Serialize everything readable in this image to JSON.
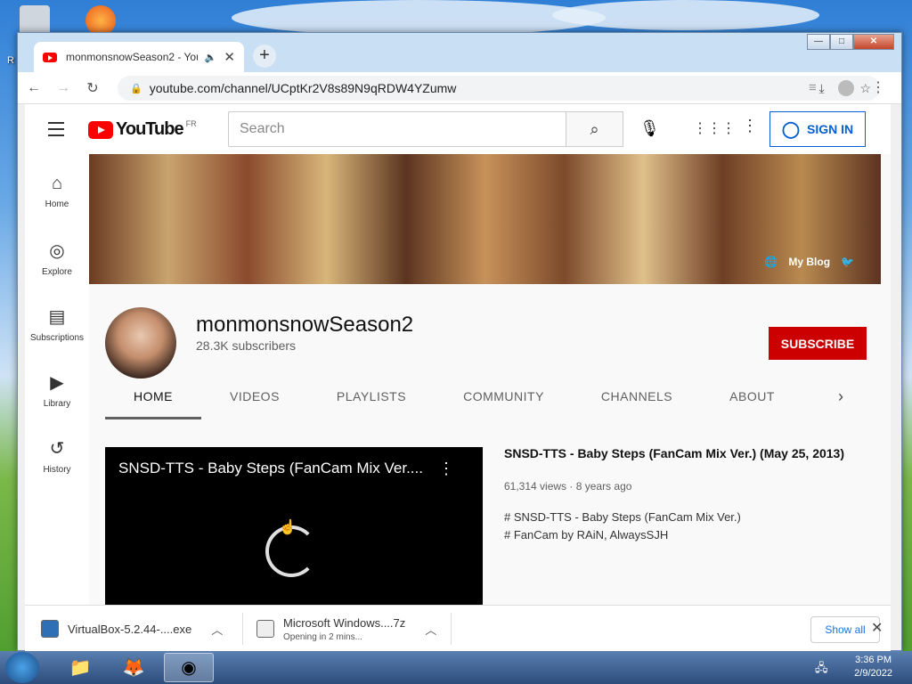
{
  "desktop": {
    "recycle_label": "R"
  },
  "tab": {
    "title": "monmonsnowSeason2 - You",
    "close": "✕",
    "new_tab": "+"
  },
  "window_controls": {
    "minimize": "—",
    "maximize": "□",
    "close": "✕"
  },
  "address_bar": {
    "url": "youtube.com/channel/UCptKr2V8s89N9qRDW4YZumw"
  },
  "youtube": {
    "logo_word": "YouTube",
    "region": "FR",
    "search_placeholder": "Search",
    "sign_in": "SIGN IN",
    "sidebar": [
      {
        "label": "Home",
        "icon": "⌂"
      },
      {
        "label": "Explore",
        "icon": "◎"
      },
      {
        "label": "Subscriptions",
        "icon": "▤"
      },
      {
        "label": "Library",
        "icon": "▶"
      },
      {
        "label": "History",
        "icon": "↺"
      }
    ],
    "banner_link": "My Blog",
    "channel": {
      "name": "monmonsnowSeason2",
      "subscribers": "28.3K subscribers",
      "subscribe": "SUBSCRIBE"
    },
    "tabs": [
      "HOME",
      "VIDEOS",
      "PLAYLISTS",
      "COMMUNITY",
      "CHANNELS",
      "ABOUT"
    ],
    "featured": {
      "player_title": "SNSD-TTS - Baby Steps (FanCam Mix Ver....",
      "title": "SNSD-TTS - Baby Steps (FanCam Mix Ver.) (May 25, 2013)",
      "meta": "61,314 views · 8 years ago",
      "desc_line1": "# SNSD-TTS - Baby Steps (FanCam Mix Ver.)",
      "desc_line2": "# FanCam by RAiN, AlwaysSJH"
    }
  },
  "downloads": {
    "item1": "VirtualBox-5.2.44-....exe",
    "item2": "Microsoft Windows....7z",
    "item2_status": "Opening in 2 mins...",
    "show_all": "Show all",
    "close": "✕"
  },
  "taskbar": {
    "time": "3:36 PM",
    "date": "2/9/2022"
  },
  "colors": {
    "youtube_red": "#ff0000",
    "subscribe_red": "#cc0000",
    "link_blue": "#065fd4"
  }
}
